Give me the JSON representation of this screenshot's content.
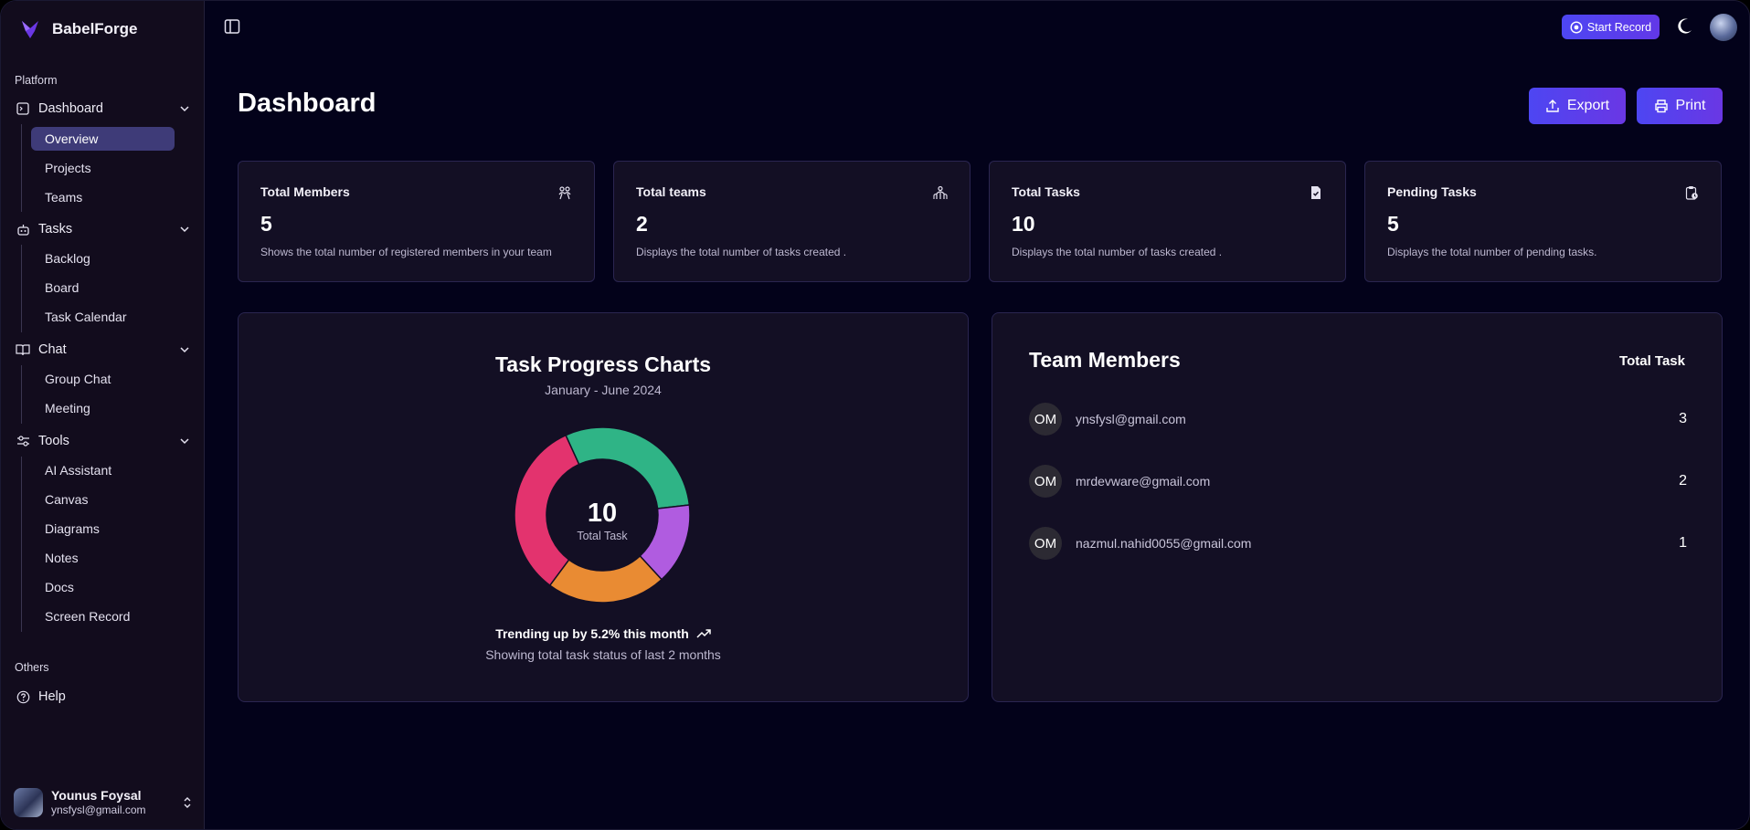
{
  "app": {
    "name": "BabelForge"
  },
  "sidebar": {
    "platform_label": "Platform",
    "groups": [
      {
        "label": "Dashboard",
        "icon": "dashboard-icon",
        "items": [
          {
            "label": "Overview",
            "active": true
          },
          {
            "label": "Projects"
          },
          {
            "label": "Teams"
          }
        ]
      },
      {
        "label": "Tasks",
        "icon": "robot-icon",
        "items": [
          {
            "label": "Backlog"
          },
          {
            "label": "Board"
          },
          {
            "label": "Task Calendar"
          }
        ]
      },
      {
        "label": "Chat",
        "icon": "book-icon",
        "items": [
          {
            "label": "Group Chat"
          },
          {
            "label": "Meeting"
          }
        ]
      },
      {
        "label": "Tools",
        "icon": "settings-icon",
        "items": [
          {
            "label": "AI Assistant"
          },
          {
            "label": "Canvas"
          },
          {
            "label": "Diagrams"
          },
          {
            "label": "Notes"
          },
          {
            "label": "Docs"
          },
          {
            "label": "Screen Record"
          }
        ]
      }
    ],
    "others_label": "Others",
    "help_label": "Help",
    "user": {
      "name": "Younus Foysal",
      "email": "ynsfysl@gmail.com"
    }
  },
  "topbar": {
    "start_record_label": "Start Record"
  },
  "header": {
    "title": "Dashboard",
    "export_label": "Export",
    "print_label": "Print"
  },
  "stats": [
    {
      "title": "Total Members",
      "value": "5",
      "desc": "Shows the total number of registered members in your team",
      "icon": "users-icon"
    },
    {
      "title": "Total teams",
      "value": "2",
      "desc": "Displays the total number of tasks created .",
      "icon": "team-icon"
    },
    {
      "title": "Total Tasks",
      "value": "10",
      "desc": "Displays the total number of tasks created .",
      "icon": "file-check-icon"
    },
    {
      "title": "Pending Tasks",
      "value": "5",
      "desc": "Displays the total number of pending tasks.",
      "icon": "clipboard-clock-icon"
    }
  ],
  "progress_chart": {
    "title": "Task Progress Charts",
    "subtitle": "January - June 2024",
    "center_value": "10",
    "center_label": "Total Task",
    "trend_text": "Trending up by 5.2% this month",
    "footer_text": "Showing total task status of last 2 months"
  },
  "chart_data": {
    "type": "pie",
    "title": "Task Progress Charts",
    "subtitle": "January - June 2024",
    "series": [
      {
        "value": 3,
        "color": "#2fb486"
      },
      {
        "value": 1.5,
        "color": "#b05ce0"
      },
      {
        "value": 2.2,
        "color": "#e98b33"
      },
      {
        "value": 3.3,
        "color": "#e3336e"
      }
    ],
    "total": 10
  },
  "team_members": {
    "title": "Team Members",
    "column_label": "Total Task",
    "rows": [
      {
        "initials": "OM",
        "email": "ynsfysl@gmail.com",
        "count": "3"
      },
      {
        "initials": "OM",
        "email": "mrdevware@gmail.com",
        "count": "2"
      },
      {
        "initials": "OM",
        "email": "nazmul.nahid0055@gmail.com",
        "count": "1"
      }
    ]
  }
}
